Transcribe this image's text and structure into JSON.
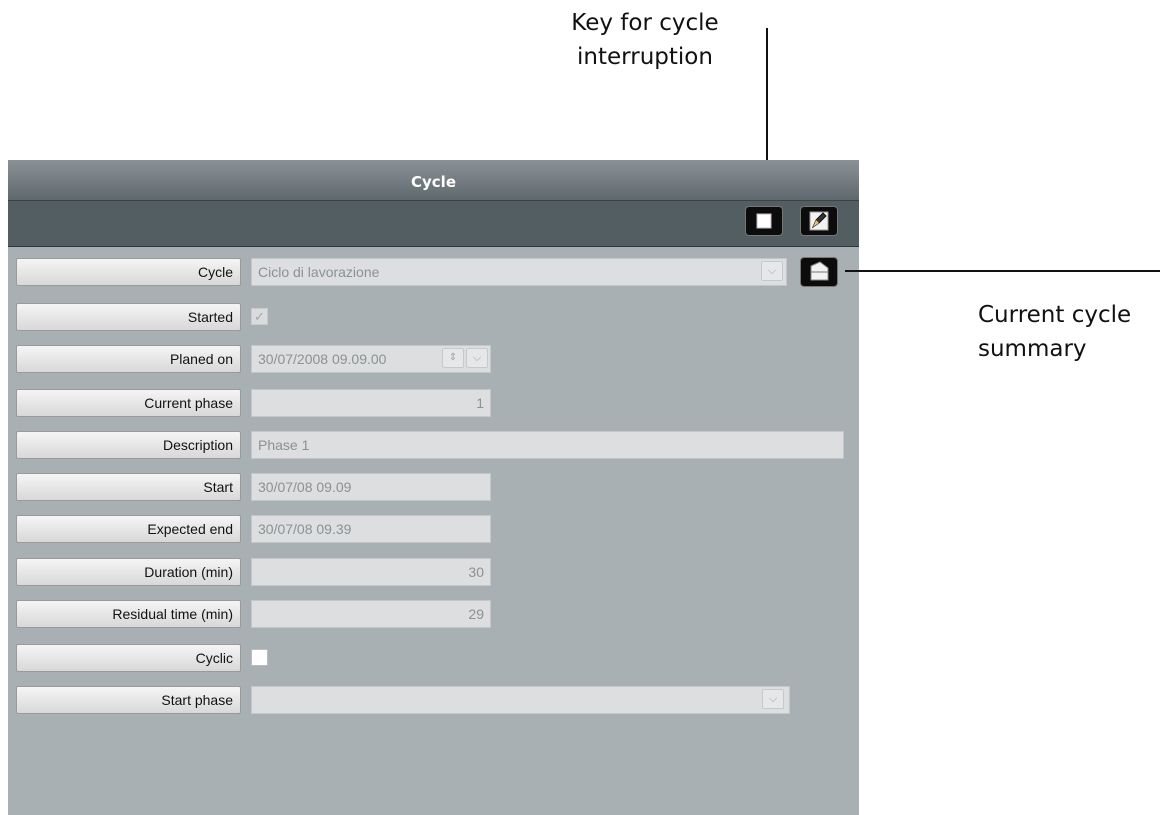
{
  "annotations": {
    "top_line1": "Key for cycle",
    "top_line2": "interruption",
    "right_line1": "Current cycle",
    "right_line2": "summary"
  },
  "window": {
    "title": "Cycle"
  },
  "toolbar": {
    "stop_icon": "stop-icon",
    "edit_icon": "pencil-icon"
  },
  "form": {
    "cycle": {
      "label": "Cycle",
      "value": "Ciclo di lavorazione"
    },
    "started": {
      "label": "Started",
      "checked": true
    },
    "planed_on": {
      "label": "Planed on",
      "value": "30/07/2008 09.09.00"
    },
    "current_phase": {
      "label": "Current phase",
      "value": "1"
    },
    "description": {
      "label": "Description",
      "value": "Phase 1"
    },
    "start": {
      "label": "Start",
      "value": "30/07/08 09.09"
    },
    "expected_end": {
      "label": "Expected end",
      "value": "30/07/08 09.39"
    },
    "duration": {
      "label": "Duration (min)",
      "value": "30"
    },
    "residual": {
      "label": "Residual time (min)",
      "value": "29"
    },
    "cyclic": {
      "label": "Cyclic",
      "checked": false
    },
    "start_phase": {
      "label": "Start phase",
      "value": ""
    }
  },
  "colors": {
    "panel_bg": "#a9b0b4",
    "toolbar_bg": "#535e63",
    "title_bg": "#6f787c",
    "field_bg": "#dcdedf"
  }
}
